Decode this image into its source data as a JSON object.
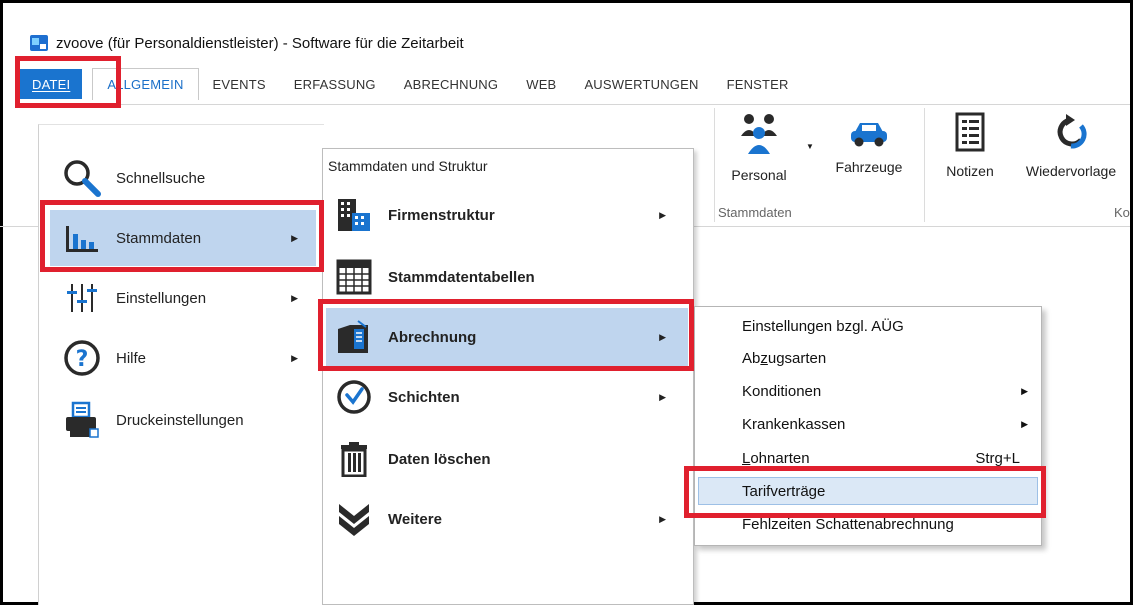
{
  "window": {
    "title": "zvoove (für Personaldienstleister) - Software für die Zeitarbeit"
  },
  "tabs": [
    "DATEI",
    "ALLGEMEIN",
    "EVENTS",
    "ERFASSUNG",
    "ABRECHNUNG",
    "WEB",
    "AUSWERTUNGEN",
    "FENSTER"
  ],
  "ribbon": {
    "buttons": [
      {
        "label": "Personal",
        "icon": "people-icon"
      },
      {
        "label": "Fahrzeuge",
        "icon": "car-icon"
      },
      {
        "label": "Notizen",
        "icon": "notes-icon"
      },
      {
        "label": "Wiedervorlage",
        "icon": "resubmission-icon"
      }
    ],
    "group_label": "Stammdaten",
    "group_label_cut": "Ko"
  },
  "app_menu": {
    "items": [
      {
        "label": "Schnellsuche",
        "icon": "search-icon",
        "has_submenu": false
      },
      {
        "label": "Stammdaten",
        "icon": "bar-chart-icon",
        "has_submenu": true,
        "highlighted": true
      },
      {
        "label": "Einstellungen",
        "icon": "sliders-icon",
        "has_submenu": true
      },
      {
        "label": "Hilfe",
        "icon": "help-icon",
        "has_submenu": true
      },
      {
        "label": "Druckeinstellungen",
        "icon": "printer-icon",
        "has_submenu": false
      }
    ]
  },
  "stammdaten_menu": {
    "header": "Stammdaten und Struktur",
    "items": [
      {
        "label": "Firmenstruktur",
        "icon": "buildings-icon",
        "has_submenu": true
      },
      {
        "label": "Stammdatentabellen",
        "icon": "table-icon",
        "has_submenu": false
      },
      {
        "label": "Abrechnung",
        "icon": "ledger-icon",
        "has_submenu": true,
        "highlighted": true
      },
      {
        "label": "Schichten",
        "icon": "clock-icon",
        "has_submenu": true
      },
      {
        "label": "Daten löschen",
        "icon": "trash-icon",
        "has_submenu": false
      },
      {
        "label": "Weitere",
        "icon": "double-chevron-icon",
        "has_submenu": true
      }
    ]
  },
  "abrechnung_menu": {
    "items": [
      {
        "label": "Einstellungen bzgl. AÜG"
      },
      {
        "label_pre": "Ab",
        "label_ul": "z",
        "label_post": "ugsarten"
      },
      {
        "label": "Konditionen",
        "has_submenu": true
      },
      {
        "label": "Krankenkassen",
        "has_submenu": true
      },
      {
        "label_pre": "",
        "label_ul": "L",
        "label_post": "ohnarten",
        "shortcut": "Strg+L"
      },
      {
        "label": "Tarifverträge",
        "highlighted": true
      },
      {
        "label": "Fehlzeiten Schattenabrechnung"
      }
    ]
  },
  "colors": {
    "accent_blue": "#1a74cf",
    "highlight": "#bfd5ee",
    "annotation_red": "#e0202e"
  }
}
